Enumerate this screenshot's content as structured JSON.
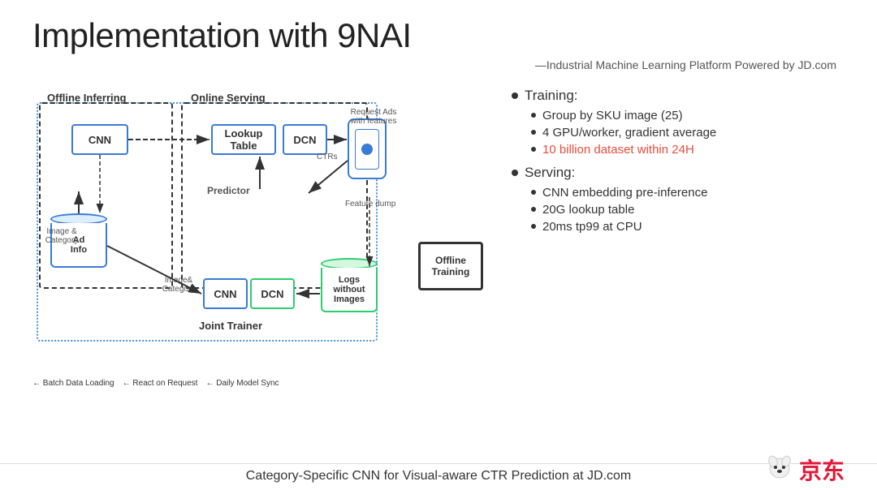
{
  "title": "Implementation with 9NAI",
  "subtitle": "—Industrial Machine Learning Platform Powered by JD.com",
  "diagram": {
    "labels": {
      "offline_inferring": "Offline Inferring",
      "online_serving": "Online Serving",
      "offline_training": "Offline\nTraining",
      "joint_trainer": "Joint Trainer",
      "predictor": "Predictor"
    },
    "boxes": {
      "cnn_top": "CNN",
      "lookup_table": "Lookup\nTable",
      "dcn_top": "DCN",
      "cnn_bottom": "CNN",
      "dcn_bottom": "DCN"
    },
    "cylinders": {
      "ad_info": "Ad\nInfo",
      "logs": "Logs\nwithout\nImages"
    },
    "arrow_labels": {
      "request_ads": "Request Ads\nwith features",
      "ctrs": "CTRs",
      "feature_dump": "Feature dump",
      "image_category1": "Image &\nCategory",
      "image_category2": "Image&\nCategory",
      "batch_loading": "Batch Data Loading",
      "react_request": "React on Request",
      "daily_sync": "Daily Model Sync"
    }
  },
  "bullets": {
    "training_label": "Training:",
    "training_items": [
      "Group by SKU image (25)",
      "4 GPU/worker, gradient average",
      "10 billion dataset within 24H"
    ],
    "training_highlight_index": 2,
    "serving_label": "Serving:",
    "serving_items": [
      "CNN embedding pre-inference",
      "20G lookup table",
      "20ms tp99 at CPU"
    ]
  },
  "footer": {
    "text": "Category-Specific CNN for Visual-aware CTR Prediction at JD.com"
  },
  "jd": {
    "text": "京东"
  }
}
